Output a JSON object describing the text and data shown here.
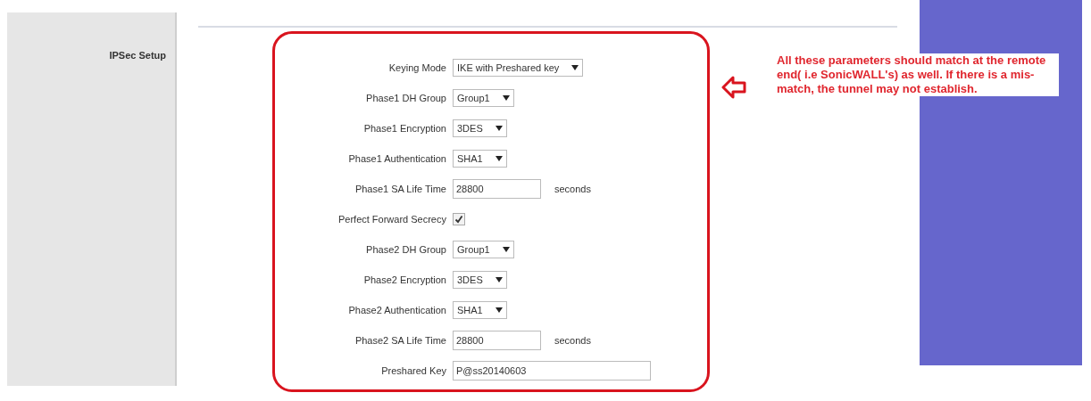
{
  "section_label": "IPSec Setup",
  "fields": [
    {
      "kind": "select",
      "label": "Keying Mode",
      "value": "IKE with Preshared key"
    },
    {
      "kind": "select",
      "label": "Phase1 DH Group",
      "value": "Group1"
    },
    {
      "kind": "select",
      "label": "Phase1 Encryption",
      "value": "3DES"
    },
    {
      "kind": "select",
      "label": "Phase1 Authentication",
      "value": "SHA1"
    },
    {
      "kind": "input",
      "label": "Phase1 SA Life Time",
      "value": "28800",
      "suffix": "seconds"
    },
    {
      "kind": "checkbox",
      "label": "Perfect Forward Secrecy",
      "checked": true
    },
    {
      "kind": "select",
      "label": "Phase2 DH Group",
      "value": "Group1"
    },
    {
      "kind": "select",
      "label": "Phase2 Encryption",
      "value": "3DES"
    },
    {
      "kind": "select",
      "label": "Phase2 Authentication",
      "value": "SHA1"
    },
    {
      "kind": "input",
      "label": "Phase2 SA Life Time",
      "value": "28800",
      "suffix": "seconds"
    },
    {
      "kind": "input",
      "label": "Preshared Key",
      "value": "P@ss20140603"
    }
  ],
  "annotation": "All these parameters should match at the remote end( i.e SonicWALL's) as well. If there is a mis-match, the tunnel may not establish."
}
